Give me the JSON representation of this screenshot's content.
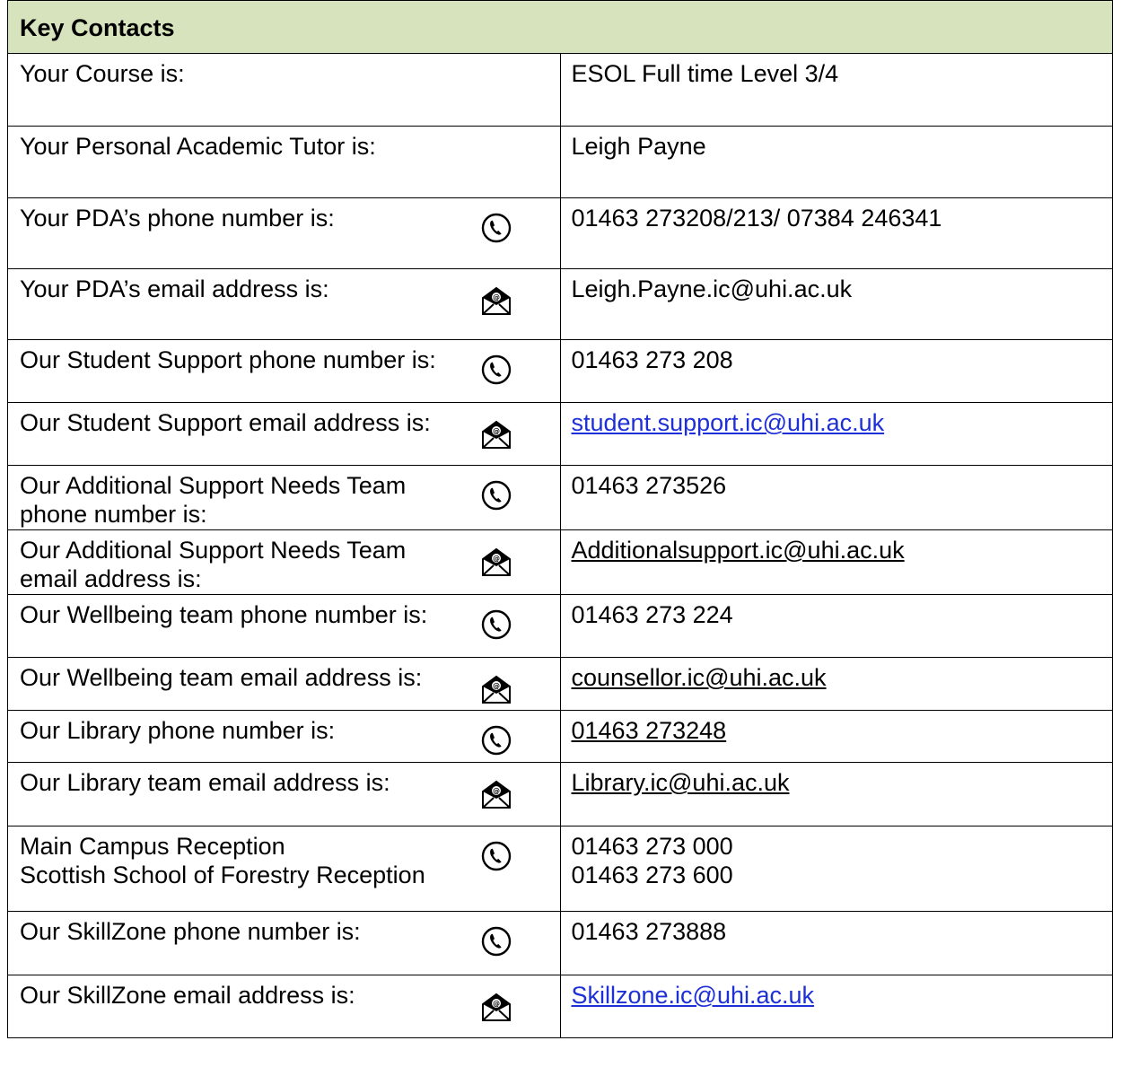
{
  "title": "Key Contacts",
  "rows": [
    {
      "label": "Your Course is:",
      "icon": "",
      "value": "ESOL Full time Level 3/4",
      "value_style": "plain"
    },
    {
      "label": "Your Personal Academic Tutor is:",
      "icon": "",
      "value": "Leigh Payne",
      "value_style": "plain"
    },
    {
      "label": "Your PDA’s phone number is:",
      "icon": "phone-icon",
      "value": "01463 273208/213/ 07384 246341",
      "value_style": "plain"
    },
    {
      "label": "Your PDA’s email address is:",
      "icon": "email-icon",
      "value": "Leigh.Payne.ic@uhi.ac.uk",
      "value_style": "plain"
    },
    {
      "label": "Our Student Support phone number is:",
      "icon": "phone-icon",
      "value": "01463 273 208",
      "value_style": "plain"
    },
    {
      "label": "Our Student Support  email address is:",
      "icon": "email-icon",
      "value": "student.support.ic@uhi.ac.uk",
      "value_style": "link-blue"
    },
    {
      "label": "Our Additional Support Needs Team phone number is:",
      "icon": "phone-icon",
      "value": "01463 273526",
      "value_style": "plain"
    },
    {
      "label": "Our  Additional Support Needs Team email address is:",
      "icon": "email-icon",
      "value": "Additionalsupport.ic@uhi.ac.uk",
      "value_style": "link"
    },
    {
      "label": "Our Wellbeing team phone number is:",
      "icon": "phone-icon",
      "value": "01463 273 224",
      "value_style": "plain"
    },
    {
      "label": "Our Wellbeing team email address is:",
      "icon": "email-icon",
      "value": "counsellor.ic@uhi.ac.uk",
      "value_style": "link"
    },
    {
      "label": "Our Library phone number is:",
      "icon": "phone-icon",
      "value": "01463 273248",
      "value_style": "link"
    },
    {
      "label": "Our Library team email address is:",
      "icon": "email-icon",
      "value": "Library.ic@uhi.ac.uk",
      "value_style": "link"
    },
    {
      "label_lines": [
        "Main Campus Reception",
        "Scottish School of Forestry Reception"
      ],
      "icon": "phone-icon",
      "value_lines": [
        "01463 273 000",
        "01463 273 600"
      ],
      "value_style": "plain"
    },
    {
      "label": "Our SkillZone phone number is:",
      "icon": "phone-icon",
      "value": "01463 273888",
      "value_style": "plain"
    },
    {
      "label": "Our SkillZone email address is:",
      "icon": "email-icon",
      "value": "Skillzone.ic@uhi.ac.uk",
      "value_style": "link-blue"
    }
  ],
  "colors": {
    "header_bg": "#d6e3bc",
    "link_blue": "#1d2fd6",
    "border": "#000000"
  }
}
